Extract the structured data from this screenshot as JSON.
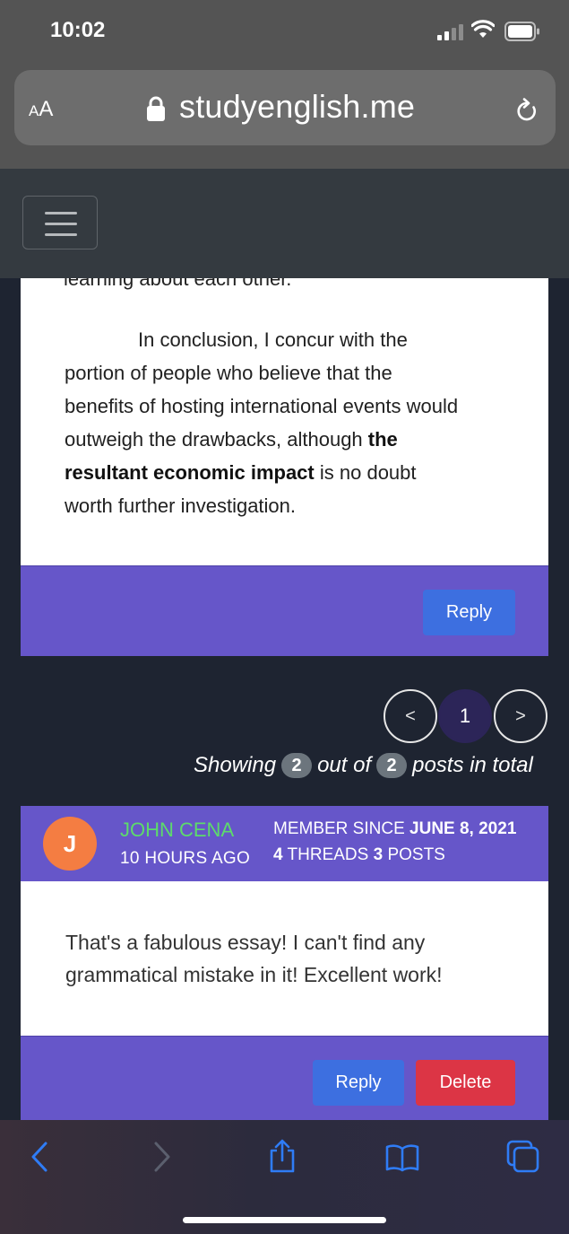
{
  "status_bar": {
    "time": "10:02"
  },
  "browser": {
    "text_size_label_small": "A",
    "text_size_label_large": "A",
    "url": "studyenglish.me"
  },
  "post1": {
    "cutoff_text": "learning about each other.",
    "paragraph_lines": [
      "In conclusion, I concur with the",
      "portion of people who believe that the",
      "benefits of hosting international events would",
      "outweigh the drawbacks, although",
      "the",
      "resultant economic impact",
      "is no doubt",
      "worth further investigation."
    ],
    "reply_label": "Reply"
  },
  "pagination": {
    "prev": "<",
    "current": "1",
    "next": ">",
    "showing_prefix": "Showing",
    "shown_count": "2",
    "middle": "out of",
    "total_count": "2",
    "suffix": "posts in total"
  },
  "post2": {
    "avatar_letter": "J",
    "author": "JOHN CENA",
    "time_ago": "10 HOURS AGO",
    "member_since_label": "MEMBER SINCE",
    "member_since_date": "JUNE 8, 2021",
    "threads_count": "4",
    "threads_label": "THREADS",
    "posts_count": "3",
    "posts_label": "POSTS",
    "content_lines": [
      "That's a fabulous essay! I can't find any",
      "grammatical mistake in it! Excellent work!"
    ],
    "reply_label": "Reply",
    "delete_label": "Delete"
  },
  "colors": {
    "card_footer": "#6656c9",
    "reply_button": "#3d6fe0",
    "delete_button": "#dc3545",
    "author_name": "#5ddb6b",
    "avatar": "#f47d42",
    "toolbar_icon": "#2f7cf6"
  }
}
